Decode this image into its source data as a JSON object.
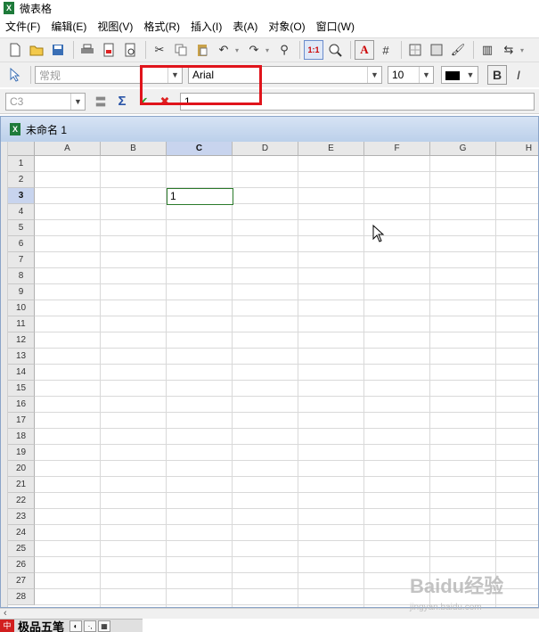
{
  "app": {
    "title": "微表格"
  },
  "menu": [
    "文件(F)",
    "编辑(E)",
    "视图(V)",
    "格式(R)",
    "插入(I)",
    "表(A)",
    "对象(O)",
    "窗口(W)"
  ],
  "toolbar": {
    "icons": [
      "new-file-icon",
      "open-folder-icon",
      "save-icon",
      "print-icon",
      "export-pdf-icon",
      "print-preview-icon",
      "cut-icon",
      "copy-icon",
      "paste-icon",
      "undo-icon",
      "redo-icon",
      "find-icon",
      "zoom-1-1-icon",
      "zoom-icon",
      "text-color-icon",
      "grid-lines-icon",
      "borders-icon",
      "fill-icon",
      "format-painter-icon",
      "columns-icon",
      "sort-icon"
    ]
  },
  "format": {
    "style_value": "常规",
    "font_value": "Arial",
    "size_value": "10",
    "color_value": "#000000",
    "bold_label": "B",
    "italic_label": "I"
  },
  "formula": {
    "cell_ref": "C3",
    "content": "1"
  },
  "document": {
    "title": "未命名 1"
  },
  "sheet": {
    "columns": [
      "A",
      "B",
      "C",
      "D",
      "E",
      "F",
      "G",
      "H"
    ],
    "active_column": "C",
    "rows": [
      "1",
      "2",
      "3",
      "4",
      "5",
      "6",
      "7",
      "8",
      "9",
      "10",
      "11",
      "12",
      "13",
      "14",
      "15",
      "16",
      "17",
      "18",
      "19",
      "20",
      "21",
      "22",
      "23",
      "24",
      "25",
      "26",
      "27",
      "28"
    ],
    "active_row": "3",
    "active_cell_value": "1"
  },
  "ime": {
    "logo": "中",
    "label": "极品五笔"
  },
  "watermark": {
    "text": "Baidu经验",
    "sub": "jingyan.baidu.com"
  }
}
